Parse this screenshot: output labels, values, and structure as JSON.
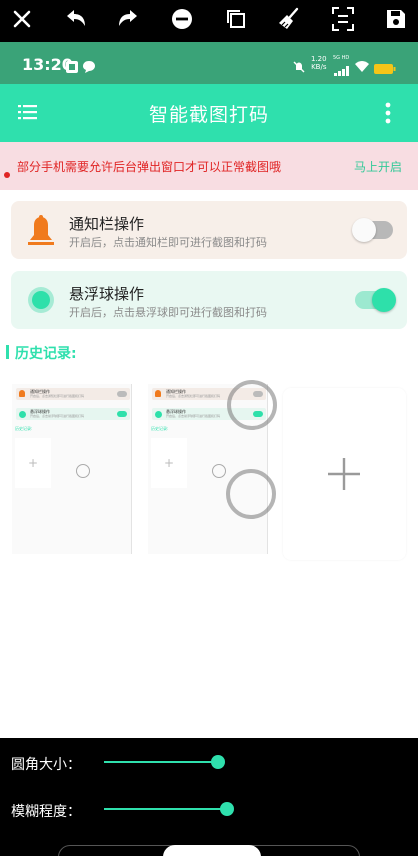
{
  "editor_toolbar": {
    "tools": [
      "close-icon",
      "undo-icon",
      "redo-icon",
      "minus-circle-icon",
      "copy-icon",
      "broom-icon",
      "crop-icon",
      "save-icon"
    ]
  },
  "status_bar": {
    "time": "13:20",
    "net_speed": "1.20",
    "net_unit": "KB/s",
    "signal_label": "5G HD"
  },
  "app_bar": {
    "title": "智能截图打码"
  },
  "notice": {
    "message": "部分手机需要允许后台弹出窗口才可以正常截图哦",
    "action": "马上开启"
  },
  "cards": [
    {
      "title": "通知栏操作",
      "subtitle": "开启后，点击通知栏即可进行截图和打码",
      "enabled": false
    },
    {
      "title": "悬浮球操作",
      "subtitle": "开启后，点击悬浮球即可进行截图和打码",
      "enabled": true
    }
  ],
  "history": {
    "label": "历史记录:"
  },
  "thumbnails": {
    "card_a": "通知栏操作",
    "card_b": "悬浮球操作",
    "history": "历史记录:",
    "sub_a": "开启后，点击通知栏即可进行截图和打码",
    "sub_b": "开启后，点击悬浮球即可进行截图和打码"
  },
  "controls": {
    "corner_label": "圆角大小：",
    "corner_value": 0.85,
    "blur_label": "模糊程度：",
    "blur_value": 0.88
  },
  "colors": {
    "accent": "#2fe0ad",
    "status_bar": "#3aa378",
    "notice_bg": "#f8dde2",
    "notice_text": "#e02424",
    "bell": "#f07a1d"
  }
}
